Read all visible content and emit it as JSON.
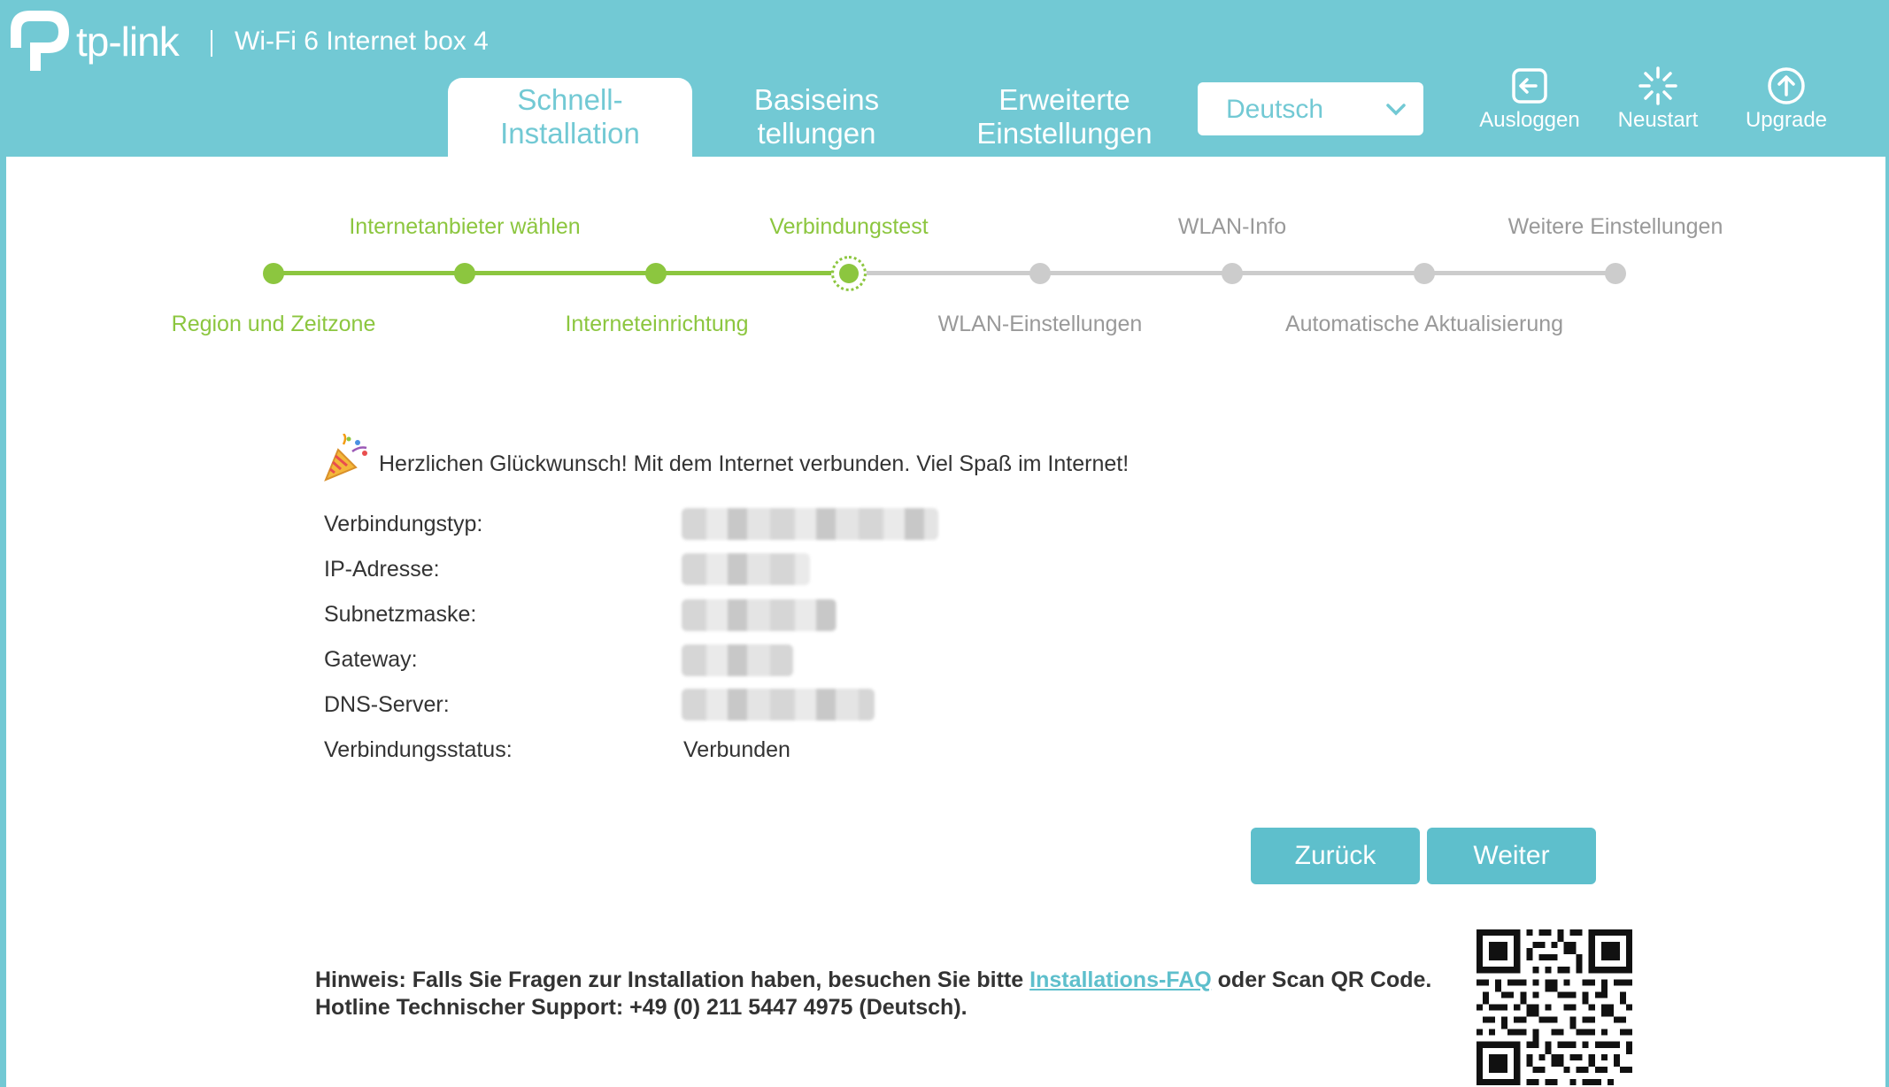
{
  "header": {
    "brand": "tp-link",
    "product": "Wi-Fi 6 Internet box 4",
    "tabs": [
      {
        "line1": "Schnell-",
        "line2": "Installation",
        "active": true
      },
      {
        "line1": "Basiseins",
        "line2": "tellungen",
        "active": false
      },
      {
        "line1": "Erweiterte",
        "line2": "Einstellungen",
        "active": false
      }
    ],
    "language": {
      "selected": "Deutsch",
      "icon": "chevron-down-icon"
    },
    "actions": [
      {
        "label": "Ausloggen",
        "icon": "logout-icon"
      },
      {
        "label": "Neustart",
        "icon": "reboot-icon"
      },
      {
        "label": "Upgrade",
        "icon": "upgrade-icon"
      }
    ],
    "accent_color": "#72c9d4"
  },
  "stepper": {
    "steps": [
      {
        "label": "Region und Zeitzone",
        "state": "done"
      },
      {
        "label": "Internetanbieter wählen",
        "state": "done"
      },
      {
        "label": "Interneteinrichtung",
        "state": "done"
      },
      {
        "label": "Verbindungstest",
        "state": "current"
      },
      {
        "label": "WLAN-Einstellungen",
        "state": "todo"
      },
      {
        "label": "WLAN-Info",
        "state": "todo"
      },
      {
        "label": "Automatische Aktualisierung",
        "state": "todo"
      },
      {
        "label": "Weitere Einstellungen",
        "state": "todo"
      }
    ],
    "done_color": "#8cc63f",
    "todo_color": "#cccccc"
  },
  "result": {
    "message": "Herzlichen Glückwunsch! Mit dem Internet verbunden. Viel Spaß im Internet!",
    "rows": [
      {
        "label": "Verbindungstyp:",
        "value": null
      },
      {
        "label": "IP-Adresse:",
        "value": null
      },
      {
        "label": "Subnetzmaske:",
        "value": null
      },
      {
        "label": "Gateway:",
        "value": null
      },
      {
        "label": "DNS-Server:",
        "value": null
      },
      {
        "label": "Verbindungsstatus:",
        "value": "Verbunden"
      }
    ]
  },
  "buttons": {
    "back": "Zurück",
    "next": "Weiter"
  },
  "note": {
    "line1_prefix": "Hinweis: Falls Sie Fragen zur Installation haben, besuchen Sie bitte ",
    "faq_link": "Installations-FAQ",
    "line1_suffix": " oder Scan QR Code.",
    "line2": "Hotline Technischer Support: +49 (0) 211 5447 4975 (Deutsch)."
  }
}
